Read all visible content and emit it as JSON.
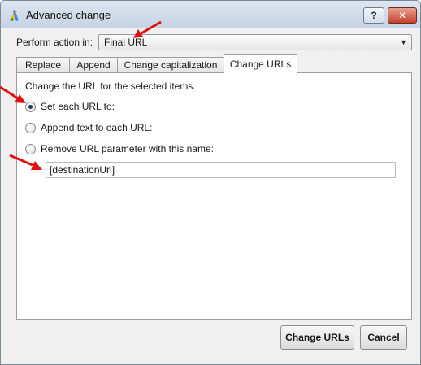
{
  "window": {
    "title": "Advanced change",
    "app_icon": "google-ads-logo-icon",
    "help_label": "?",
    "close_label": "✕"
  },
  "perform": {
    "label": "Perform action in:",
    "selected": "Final URL",
    "dropdown_icon": "chevron-down-icon"
  },
  "tabs": [
    {
      "label": "Replace"
    },
    {
      "label": "Append"
    },
    {
      "label": "Change capitalization"
    },
    {
      "label": "Change URLs",
      "active": true
    }
  ],
  "panel": {
    "description": "Change the URL for the selected items.",
    "options": [
      {
        "label": "Set each URL to:",
        "checked": true
      },
      {
        "label": "Append text to each URL:",
        "checked": false
      },
      {
        "label": "Remove URL parameter with this name:",
        "checked": false
      }
    ],
    "input_value": "[destinationUrl]"
  },
  "buttons": {
    "primary": "Change URLs",
    "cancel": "Cancel"
  },
  "annotation_color": "#e01010"
}
